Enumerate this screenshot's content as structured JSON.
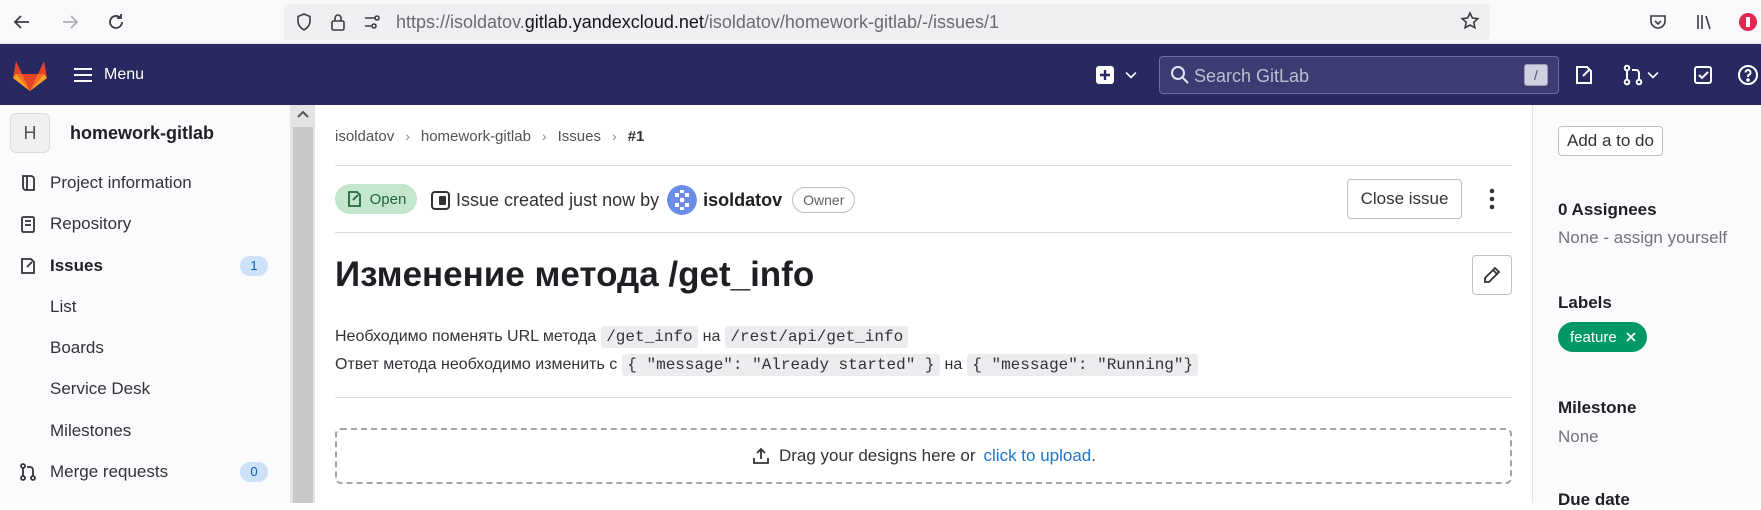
{
  "browser": {
    "url_prefix": "https://isoldatov.",
    "url_domain": "gitlab.yandexcloud.net",
    "url_path": "/isoldatov/homework-gitlab/-/issues/1"
  },
  "header": {
    "menu_label": "Menu",
    "search_placeholder": "Search GitLab",
    "search_shortcut": "/"
  },
  "sidebar": {
    "project_initial": "H",
    "project_name": "homework-gitlab",
    "items": [
      {
        "label": "Project information"
      },
      {
        "label": "Repository"
      },
      {
        "label": "Issues",
        "badge": "1"
      },
      {
        "label": "List"
      },
      {
        "label": "Boards"
      },
      {
        "label": "Service Desk"
      },
      {
        "label": "Milestones"
      },
      {
        "label": "Merge requests",
        "badge": "0"
      }
    ]
  },
  "breadcrumb": [
    "isoldatov",
    "homework-gitlab",
    "Issues",
    "#1"
  ],
  "issue": {
    "status": "Open",
    "meta_text": "Issue created just now by",
    "author": "isoldatov",
    "author_role": "Owner",
    "close_label": "Close issue",
    "title": "Изменение метода /get_info",
    "desc_line1": {
      "t1": "Необходимо поменять URL метода",
      "code1": "/get_info",
      "t2": "на",
      "code2": "/rest/api/get_info"
    },
    "desc_line2": {
      "t1": "Ответ метода необходимо изменить с",
      "code1": "{ \"message\": \"Already started\" }",
      "t2": "на",
      "code2": "{ \"message\": \"Running\"}"
    },
    "upload_text": "Drag your designs here or",
    "upload_link": "click to upload",
    "upload_end": "."
  },
  "right_sidebar": {
    "todo_label": "Add a to do",
    "assignees_head": "0 Assignees",
    "assignees_value": "None - assign yourself",
    "labels_head": "Labels",
    "label_chip": "feature",
    "milestone_head": "Milestone",
    "milestone_value": "None",
    "due_head": "Due date"
  },
  "colors": {
    "header_bg": "#292961",
    "label_feature": "#009966",
    "status_open_bg": "#c3e6cd",
    "link": "#1f75cb"
  }
}
